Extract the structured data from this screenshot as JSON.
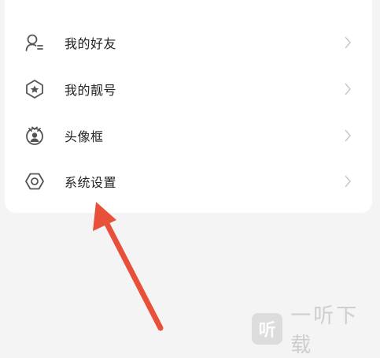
{
  "menu": {
    "items": [
      {
        "label": "我的好友",
        "icon": "friends-icon"
      },
      {
        "label": "我的靓号",
        "icon": "pretty-number-icon"
      },
      {
        "label": "头像框",
        "icon": "avatar-frame-icon"
      },
      {
        "label": "系统设置",
        "icon": "settings-icon"
      }
    ]
  },
  "annotation": {
    "arrow_color": "#e8503a"
  },
  "watermark": {
    "logo_text": "听",
    "text": "一听下载"
  },
  "colors": {
    "background": "#f4f4f4",
    "card": "#ffffff",
    "text": "#222222",
    "icon": "#555555",
    "chevron": "#c8c8c8"
  }
}
